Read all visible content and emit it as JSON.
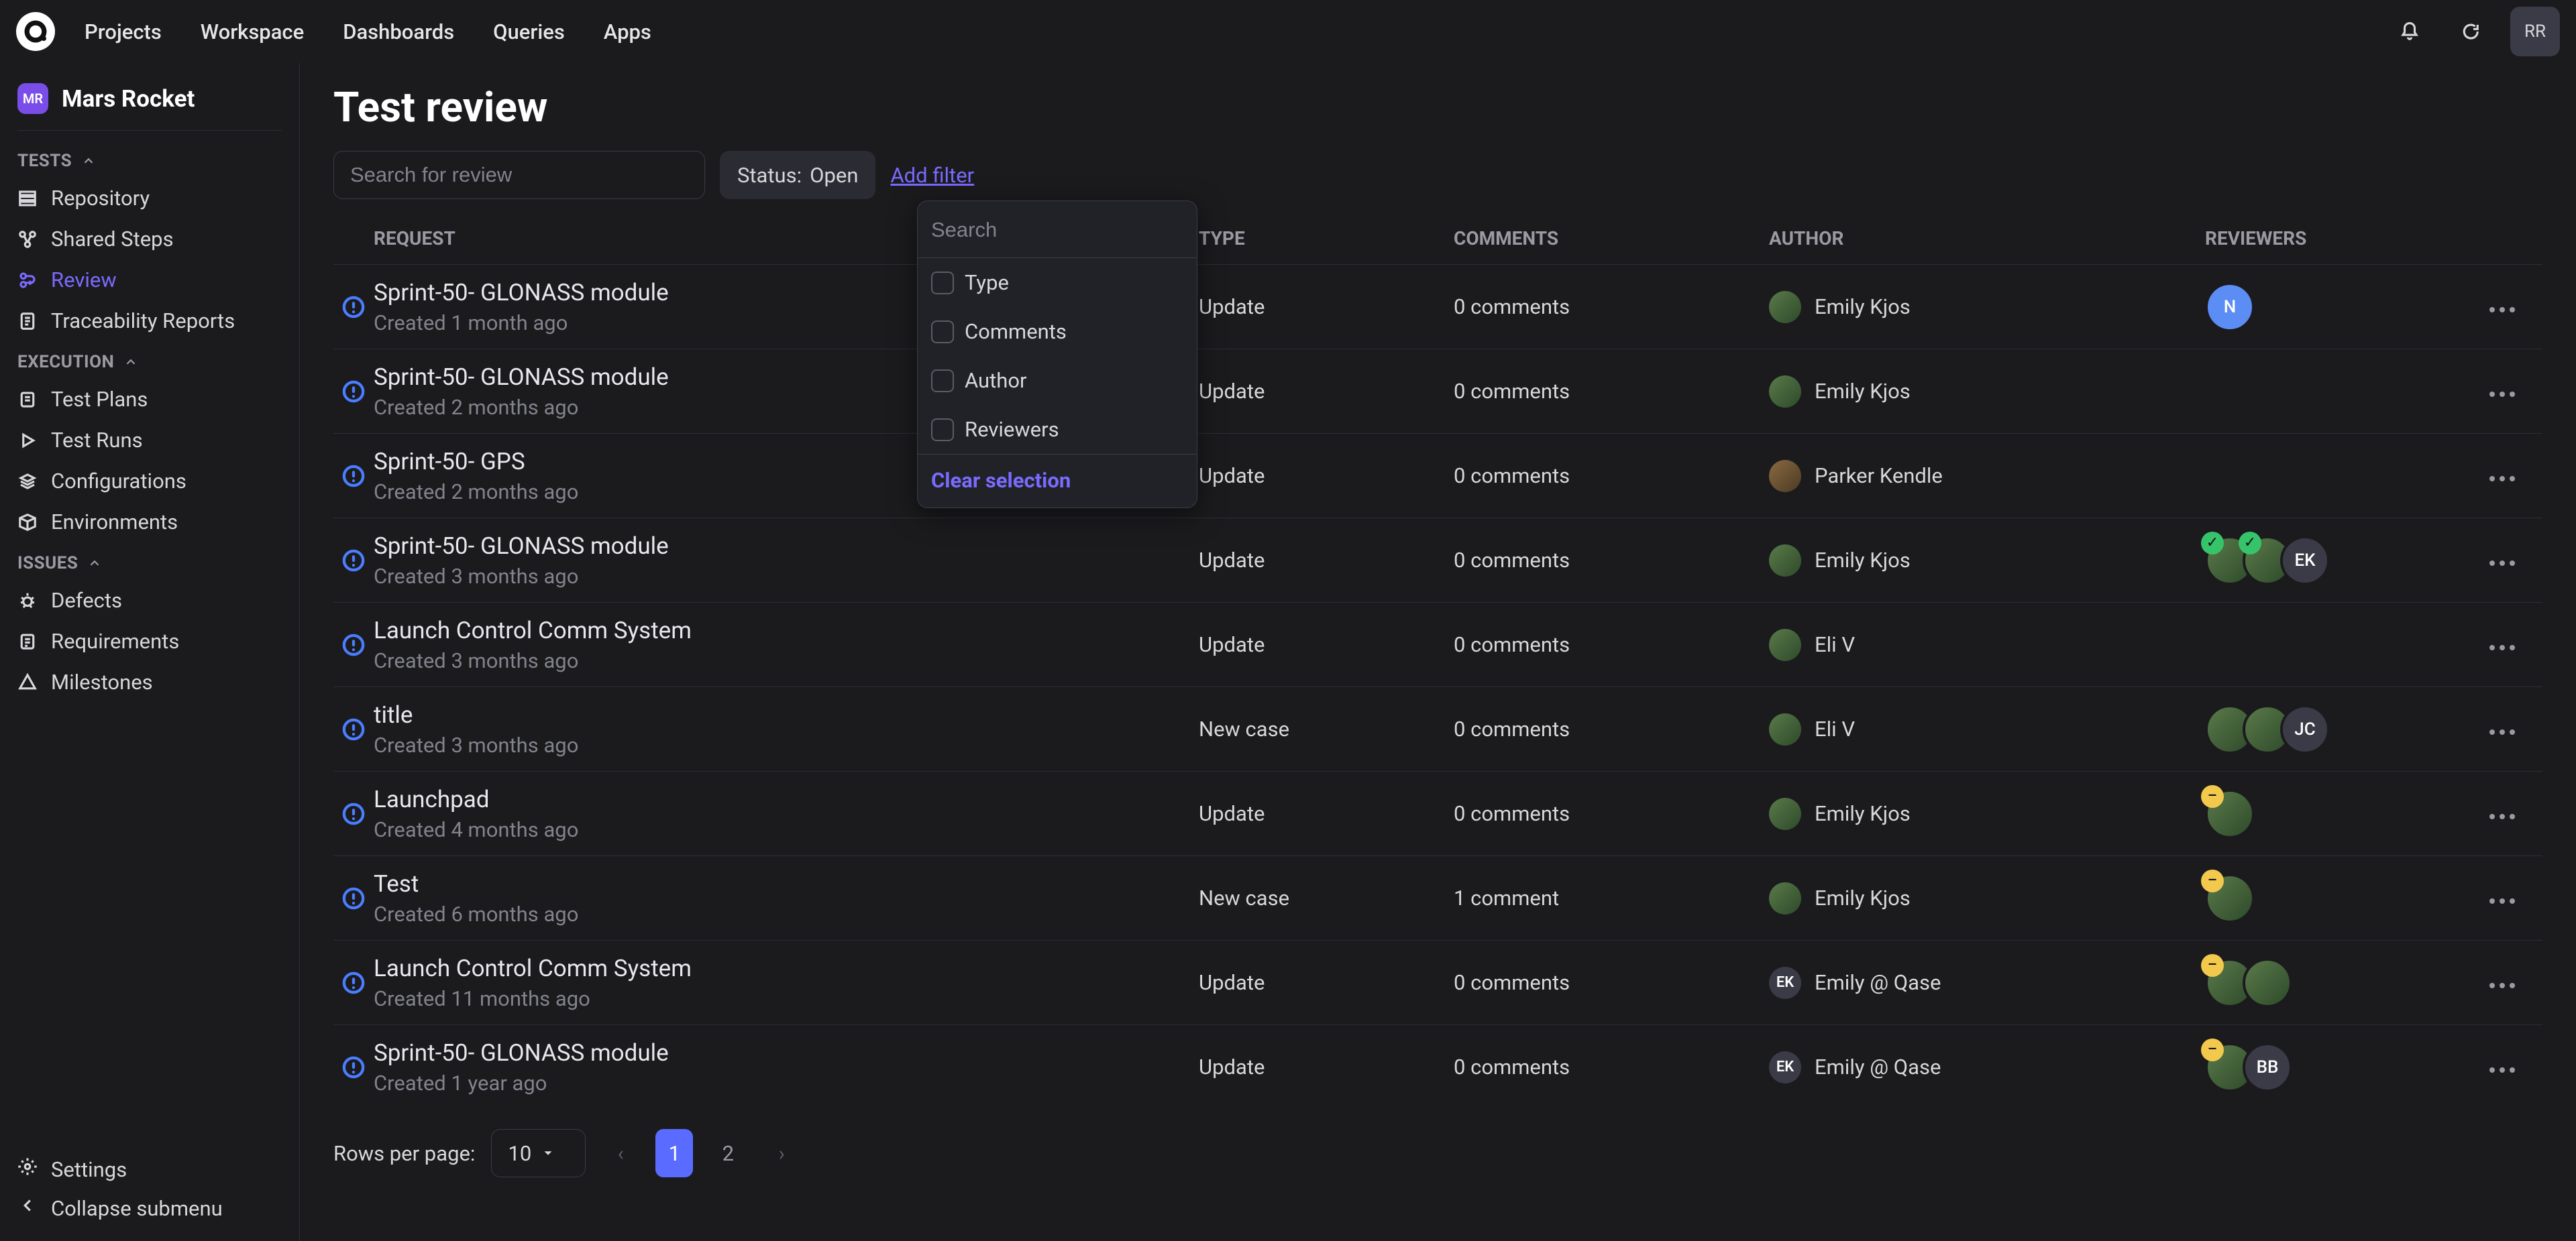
{
  "topnav": {
    "items": [
      "Projects",
      "Workspace",
      "Dashboards",
      "Queries",
      "Apps"
    ],
    "avatar_initials": "RR"
  },
  "project": {
    "chip": "MR",
    "name": "Mars Rocket"
  },
  "sections": {
    "tests_label": "TESTS",
    "execution_label": "EXECUTION",
    "issues_label": "ISSUES"
  },
  "sidebar": {
    "tests": [
      {
        "icon": "repository-icon",
        "label": "Repository"
      },
      {
        "icon": "shared-steps-icon",
        "label": "Shared Steps"
      },
      {
        "icon": "review-icon",
        "label": "Review"
      },
      {
        "icon": "traceability-icon",
        "label": "Traceability Reports"
      }
    ],
    "execution": [
      {
        "icon": "test-plans-icon",
        "label": "Test Plans"
      },
      {
        "icon": "test-runs-icon",
        "label": "Test Runs"
      },
      {
        "icon": "configurations-icon",
        "label": "Configurations"
      },
      {
        "icon": "environments-icon",
        "label": "Environments"
      }
    ],
    "issues": [
      {
        "icon": "defects-icon",
        "label": "Defects"
      },
      {
        "icon": "requirements-icon",
        "label": "Requirements"
      },
      {
        "icon": "milestones-icon",
        "label": "Milestones"
      }
    ],
    "footer": {
      "settings": "Settings",
      "collapse": "Collapse submenu"
    }
  },
  "page": {
    "title": "Test review"
  },
  "toolbar": {
    "search_placeholder": "Search for review",
    "status_label": "Status: ",
    "status_value": "Open",
    "add_filter": "Add filter"
  },
  "popover": {
    "search_placeholder": "Search",
    "options": [
      "Type",
      "Comments",
      "Author",
      "Reviewers"
    ],
    "clear": "Clear selection"
  },
  "columns": {
    "request": "REQUEST",
    "type": "TYPE",
    "comments": "COMMENTS",
    "author": "AUTHOR",
    "reviewers": "REVIEWERS"
  },
  "rows": [
    {
      "title": "Sprint-50- GLONASS module",
      "created": "Created 1 month ago",
      "type": "Update",
      "comments": "0 comments",
      "author": {
        "name": "Emily Kjos",
        "avatar": "img"
      },
      "reviewers": [
        {
          "kind": "chip",
          "text": "N",
          "cls": "chip-N"
        }
      ]
    },
    {
      "title": "Sprint-50- GLONASS module",
      "created": "Created 2 months ago",
      "type": "Update",
      "comments": "0 comments",
      "author": {
        "name": "Emily Kjos",
        "avatar": "img"
      },
      "reviewers": []
    },
    {
      "title": "Sprint-50- GPS",
      "created": "Created 2 months ago",
      "type": "Update",
      "comments": "0 comments",
      "author": {
        "name": "Parker Kendle",
        "avatar": "img2"
      },
      "reviewers": []
    },
    {
      "title": "Sprint-50- GLONASS module",
      "created": "Created 3 months ago",
      "type": "Update",
      "comments": "0 comments",
      "author": {
        "name": "Emily Kjos",
        "avatar": "img"
      },
      "reviewers": [
        {
          "kind": "avatar",
          "cls": "avatar-img",
          "badge": "green"
        },
        {
          "kind": "avatar",
          "cls": "avatar-img",
          "badge": "green"
        },
        {
          "kind": "chip",
          "text": "EK",
          "cls": "chip-EK"
        }
      ]
    },
    {
      "title": "Launch Control Comm System",
      "created": "Created 3 months ago",
      "type": "Update",
      "comments": "0 comments",
      "author": {
        "name": "Eli V",
        "avatar": "img"
      },
      "reviewers": []
    },
    {
      "title": "title",
      "created": "Created 3 months ago",
      "type": "New case",
      "comments": "0 comments",
      "author": {
        "name": "Eli V",
        "avatar": "img"
      },
      "reviewers": [
        {
          "kind": "avatar",
          "cls": "avatar-img"
        },
        {
          "kind": "avatar",
          "cls": "avatar-img"
        },
        {
          "kind": "chip",
          "text": "JC",
          "cls": "chip-JC"
        }
      ]
    },
    {
      "title": "Launchpad",
      "created": "Created 4 months ago",
      "type": "Update",
      "comments": "0 comments",
      "author": {
        "name": "Emily Kjos",
        "avatar": "img"
      },
      "reviewers": [
        {
          "kind": "avatar",
          "cls": "avatar-img",
          "badge": "yellow"
        }
      ]
    },
    {
      "title": "Test",
      "created": "Created 6 months ago",
      "type": "New case",
      "comments": "1 comment",
      "author": {
        "name": "Emily Kjos",
        "avatar": "img"
      },
      "reviewers": [
        {
          "kind": "avatar",
          "cls": "avatar-img",
          "badge": "yellow"
        }
      ]
    },
    {
      "title": "Launch Control Comm System",
      "created": "Created 11 months ago",
      "type": "Update",
      "comments": "0 comments",
      "author": {
        "name": "Emily @ Qase",
        "avatar": "ek"
      },
      "reviewers": [
        {
          "kind": "avatar",
          "cls": "avatar-img",
          "badge": "yellow"
        },
        {
          "kind": "avatar",
          "cls": "avatar-img"
        }
      ]
    },
    {
      "title": "Sprint-50- GLONASS module",
      "created": "Created 1 year ago",
      "type": "Update",
      "comments": "0 comments",
      "author": {
        "name": "Emily @ Qase",
        "avatar": "ek"
      },
      "reviewers": [
        {
          "kind": "avatar",
          "cls": "avatar-img",
          "badge": "yellow"
        },
        {
          "kind": "chip",
          "text": "BB",
          "cls": "chip-BB"
        }
      ]
    }
  ],
  "pager": {
    "rows_label": "Rows per page:",
    "rows_value": "10",
    "pages": [
      "1",
      "2"
    ],
    "active_page": "1",
    "prev": "‹",
    "next": "›"
  }
}
